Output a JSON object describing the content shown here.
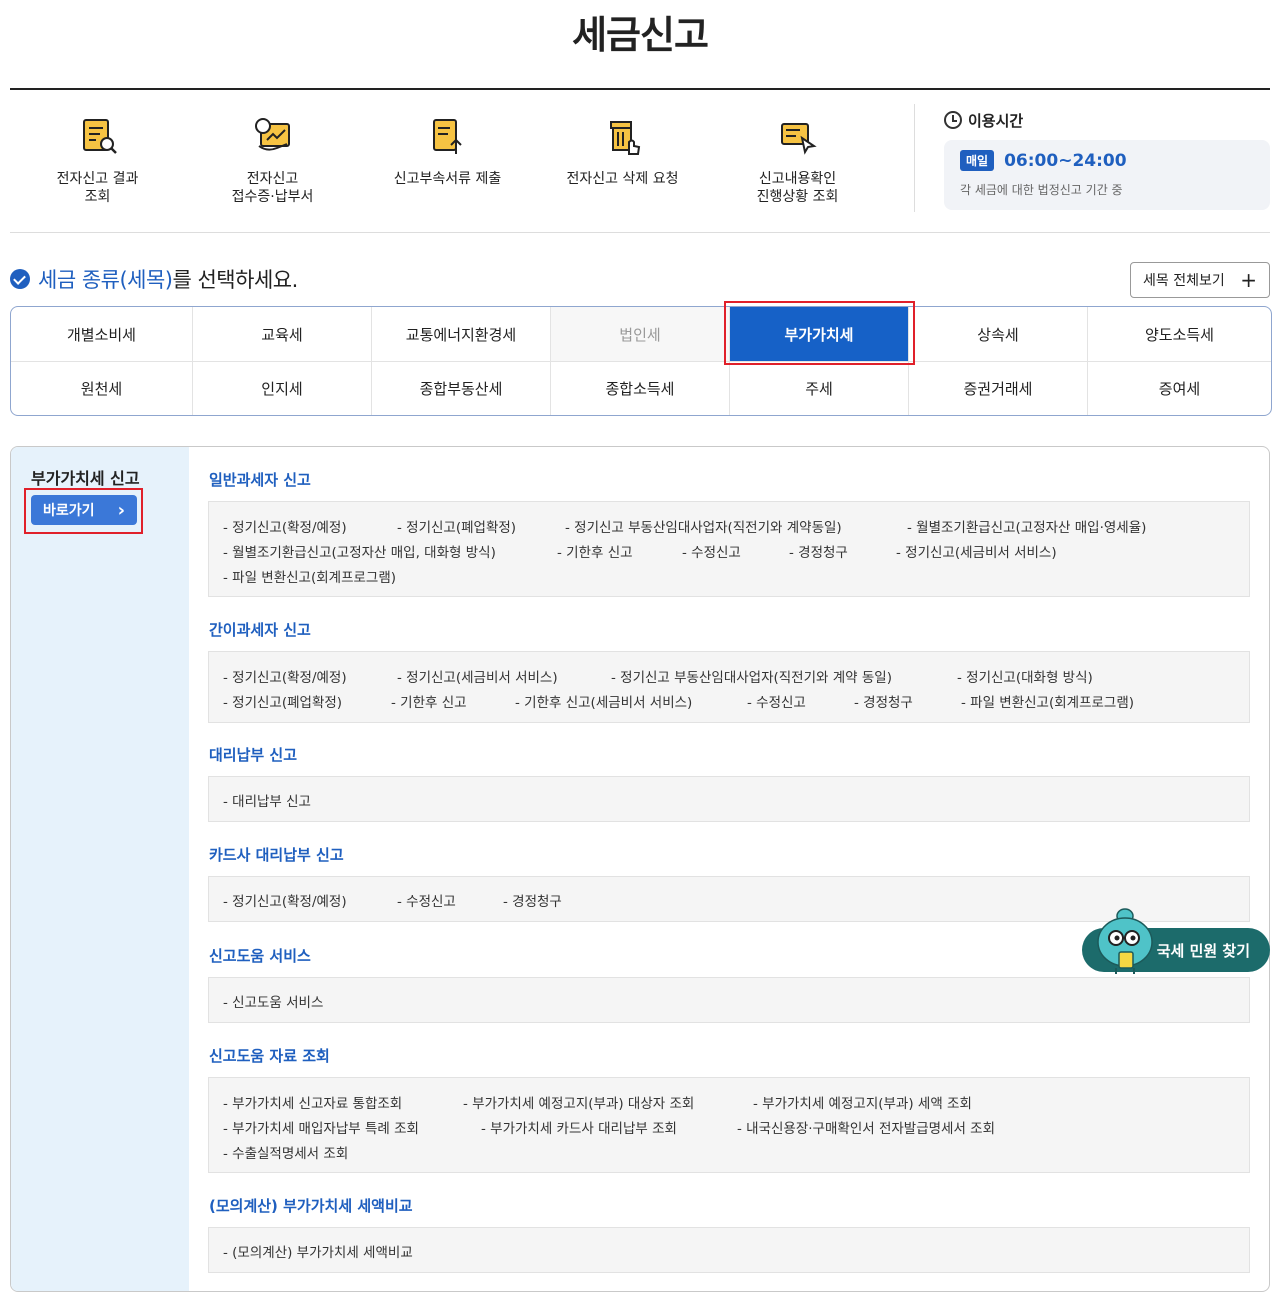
{
  "page": {
    "title": "세금신고"
  },
  "quick_menu": [
    {
      "label": "전자신고 결과\n조회",
      "icon": "document-search-icon"
    },
    {
      "label": "전자신고\n접수증·납부서",
      "icon": "receipt-icon"
    },
    {
      "label": "신고부속서류 제출",
      "icon": "document-upload-icon"
    },
    {
      "label": "전자신고 삭제 요청",
      "icon": "delete-request-icon"
    },
    {
      "label": "신고내용확인\n진행상황 조회",
      "icon": "progress-check-icon"
    }
  ],
  "hours": {
    "title": "이용시간",
    "badge": "매일",
    "time": "06:00~24:00",
    "note": "각 세금에 대한 법정신고 기간 중"
  },
  "tax_select": {
    "heading_highlight": "세금 종류(세목)",
    "heading_rest": "를 선택하세요.",
    "view_all": "세목 전체보기",
    "view_all_icon": "+",
    "row1": [
      "개별소비세",
      "교육세",
      "교통에너지환경세",
      "법인세",
      "부가가치세",
      "상속세",
      "양도소득세"
    ],
    "row2": [
      "원천세",
      "인지세",
      "종합부동산세",
      "종합소득세",
      "주세",
      "증권거래세",
      "증여세"
    ],
    "active": "부가가치세",
    "disabled": "법인세"
  },
  "detail": {
    "side_title": "부가가치세 신고",
    "go_button": "바로가기",
    "go_chevron": "›",
    "sections": [
      {
        "title": "일반과세자 신고",
        "links": [
          "- 정기신고(확정/예정)",
          "- 정기신고(폐업확정)",
          "- 정기신고 부동산임대사업자(직전기와 계약동일)",
          "- 월별조기환급신고(고정자산 매입·영세율)",
          "- 월별조기환급신고(고정자산 매입, 대화형 방식)",
          "- 기한후 신고",
          "- 수정신고",
          "- 경정청구",
          "- 정기신고(세금비서 서비스)",
          "- 파일 변환신고(회계프로그램)"
        ]
      },
      {
        "title": "간이과세자 신고",
        "links": [
          "- 정기신고(확정/예정)",
          "- 정기신고(세금비서 서비스)",
          "- 정기신고 부동산임대사업자(직전기와 계약 동일)",
          "- 정기신고(대화형 방식)",
          "- 정기신고(폐업확정)",
          "- 기한후 신고",
          "- 기한후 신고(세금비서 서비스)",
          "- 수정신고",
          "- 경정청구",
          "- 파일 변환신고(회계프로그램)"
        ]
      },
      {
        "title": "대리납부 신고",
        "links": [
          "- 대리납부 신고"
        ]
      },
      {
        "title": "카드사 대리납부 신고",
        "links": [
          "- 정기신고(확정/예정)",
          "- 수정신고",
          "- 경정청구"
        ]
      },
      {
        "title": "신고도움 서비스",
        "links": [
          "- 신고도움 서비스"
        ]
      },
      {
        "title": "신고도움 자료 조회",
        "links": [
          "- 부가가치세 신고자료 통합조회",
          "- 부가가치세 예정고지(부과) 대상자 조회",
          "- 부가가치세 예정고지(부과) 세액 조회",
          "- 부가가치세 매입자납부 특례 조회",
          "- 부가가치세 카드사 대리납부 조회",
          "- 내국신용장·구매확인서 전자발급명세서 조회",
          "- 수출실적명세서 조회"
        ]
      },
      {
        "title": "(모의계산) 부가가치세 세액비교",
        "links": [
          "- (모의계산) 부가가치세 세액비교"
        ]
      }
    ]
  },
  "floating": {
    "label": "국세 민원 찾기"
  },
  "colors": {
    "primary": "#1f5fbf",
    "active_tab": "#1661c7",
    "highlight_frame": "#e0202a",
    "float_button": "#1c6b6b",
    "side_bg": "#e6f2fb"
  }
}
